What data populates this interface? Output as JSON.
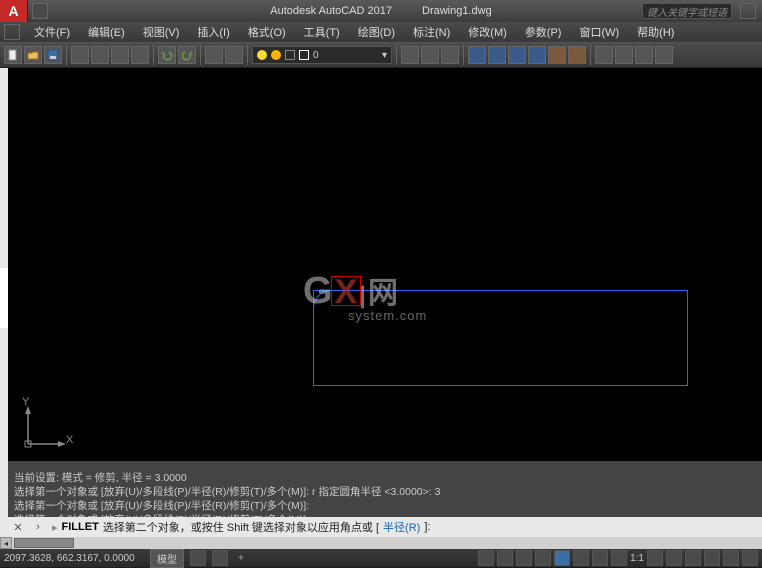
{
  "title": {
    "app": "Autodesk AutoCAD 2017",
    "doc": "Drawing1.dwg",
    "logo": "A"
  },
  "search": {
    "placeholder": "键入关键字或短语"
  },
  "menu": {
    "items": [
      "文件(F)",
      "编辑(E)",
      "视图(V)",
      "插入(I)",
      "格式(O)",
      "工具(T)",
      "绘图(D)",
      "标注(N)",
      "修改(M)",
      "参数(P)",
      "窗口(W)",
      "帮助(H)"
    ]
  },
  "layer": {
    "current": "0"
  },
  "ucs": {
    "x": "X",
    "y": "Y"
  },
  "watermark": {
    "main": "G",
    "x": "X",
    "net": "网",
    "sub": "system.com"
  },
  "cmd": {
    "history": [
      {
        "text": "当前设置: 模式 = 修剪, 半径 = 3.0000"
      },
      {
        "text": "选择第一个对象或 [放弃(U)/多段线(P)/半径(R)/修剪(T)/多个(M)]: r 指定圆角半径 <3.0000>: 3"
      },
      {
        "text": "选择第一个对象或 [放弃(U)/多段线(P)/半径(R)/修剪(T)/多个(M)]:"
      },
      {
        "text": "选择第一个对象或 [放弃(U)/多段线(P)/半径(R)/修剪(T)/多个(M)]:"
      }
    ],
    "active_cmd": "FILLET",
    "prompt_text": "选择第二个对象，或按住 Shift 键选择对象以应用角点或 [",
    "option": "半径(R)",
    "prompt_tail": "]:"
  },
  "status": {
    "coords": "2097.3628, 662.3167, 0.0000",
    "model_tab": "模型",
    "scale": "1:1",
    "tabs_plus": "+"
  },
  "icons": {
    "save": "save-icon",
    "open": "open-icon",
    "undo": "undo-icon",
    "redo": "redo-icon"
  }
}
